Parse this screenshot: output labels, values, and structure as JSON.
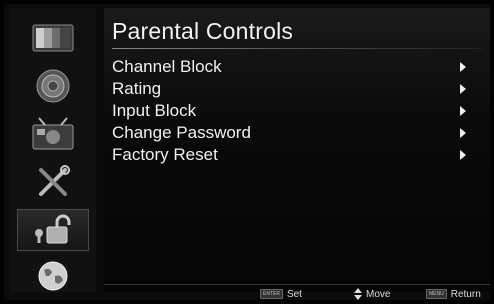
{
  "screen": {
    "title": "Parental Controls"
  },
  "sidebar": {
    "items": [
      {
        "name": "picture-icon"
      },
      {
        "name": "sound-icon"
      },
      {
        "name": "channel-icon"
      },
      {
        "name": "setup-tools-icon"
      },
      {
        "name": "lock-icon"
      },
      {
        "name": "globe-icon"
      }
    ],
    "selected": "lock-icon"
  },
  "menu": {
    "items": [
      {
        "label": "Channel Block"
      },
      {
        "label": "Rating"
      },
      {
        "label": "Input Block"
      },
      {
        "label": "Change Password"
      },
      {
        "label": "Factory Reset"
      }
    ]
  },
  "footer": {
    "enter_key": "ENTER",
    "set_label": "Set",
    "move_label": "Move",
    "menu_key": "MENU",
    "return_label": "Return"
  }
}
